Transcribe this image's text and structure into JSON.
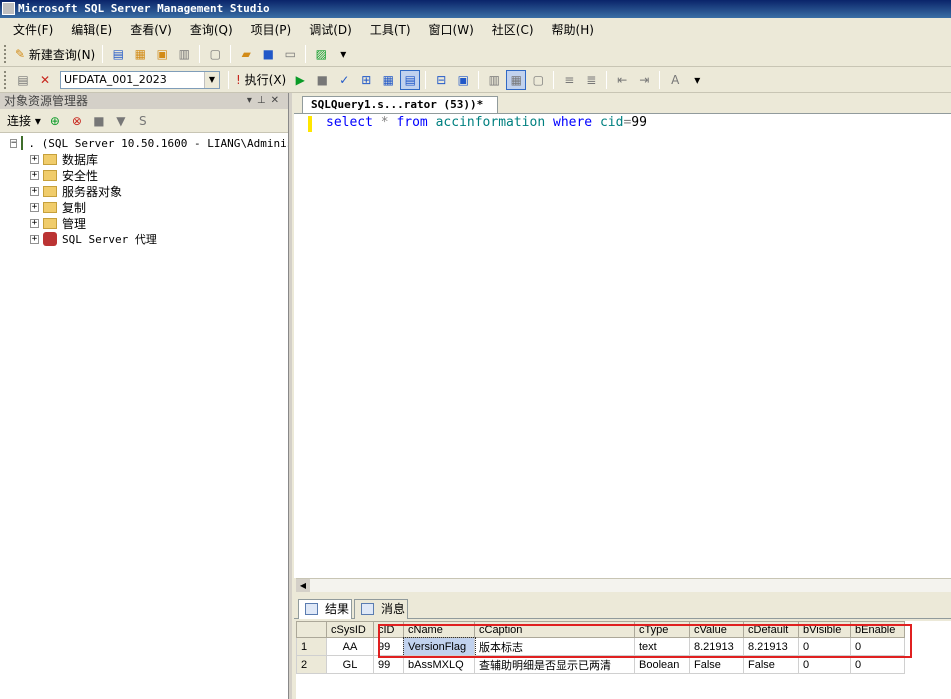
{
  "window": {
    "title": "Microsoft SQL Server Management Studio"
  },
  "menu": [
    "文件(F)",
    "编辑(E)",
    "查看(V)",
    "查询(Q)",
    "项目(P)",
    "调试(D)",
    "工具(T)",
    "窗口(W)",
    "社区(C)",
    "帮助(H)"
  ],
  "toolbar": {
    "new_query": "新建查询(N)",
    "database": "UFDATA_001_2023",
    "execute": "执行(X)"
  },
  "object_explorer": {
    "title": "对象资源管理器",
    "connect": "连接",
    "server": ". (SQL Server 10.50.1600 - LIANG\\Adminis",
    "nodes": [
      "数据库",
      "安全性",
      "服务器对象",
      "复制",
      "管理",
      "SQL Server 代理"
    ]
  },
  "tab": {
    "label": "SQLQuery1.s...rator (53))*"
  },
  "editor": {
    "sql": {
      "select": "select",
      "star": "*",
      "from": "from",
      "table": "accinformation",
      "where": "where",
      "condition": "cid",
      "eq": "=",
      "value": "99"
    }
  },
  "results": {
    "tab_results": "结果",
    "tab_messages": "消息",
    "columns": [
      "cSysID",
      "cID",
      "cName",
      "cCaption",
      "cType",
      "cValue",
      "cDefault",
      "bVisible",
      "bEnable"
    ],
    "rows": [
      {
        "num": "1",
        "cells": [
          "AA",
          "99",
          "VersionFlag",
          "版本标志",
          "text",
          "8.21913",
          "8.21913",
          "0",
          "0"
        ]
      },
      {
        "num": "2",
        "cells": [
          "GL",
          "99",
          "bAssMXLQ",
          "查辅助明细是否显示已两清",
          "Boolean",
          "False",
          "False",
          "0",
          "0"
        ]
      }
    ]
  },
  "colors": {
    "highlight": "#e02020",
    "keyword": "#0000ff",
    "identifier": "#008080"
  }
}
